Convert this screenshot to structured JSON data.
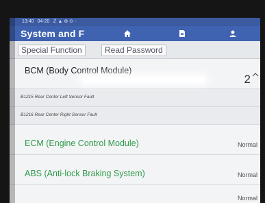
{
  "statusbar": {
    "time": "13:40",
    "date": "04-20",
    "extra": "ℤ ▲ ⊕ ⊙ ·"
  },
  "header": {
    "title": "System and F",
    "icons": [
      "home-icon",
      "document-icon",
      "user-icon"
    ]
  },
  "tabs": [
    {
      "label": "Special Function"
    },
    {
      "label": "Read Password"
    }
  ],
  "modules": [
    {
      "name": "BCM (Body Control Module)",
      "status": "2",
      "faults": [
        "B1215 Rear Center Left Sensor Fault",
        "B1216 Rear Center Right Sensor Fault"
      ]
    },
    {
      "name": "ECM (Engine Control Module)",
      "status": "Normal"
    },
    {
      "name": "ABS (Anti-lock Braking System)",
      "status": "Normal"
    },
    {
      "name": "",
      "status": "Normal"
    }
  ],
  "colors": {
    "header_bg": "#3f63b0",
    "ok_text": "#2f9a4a"
  }
}
